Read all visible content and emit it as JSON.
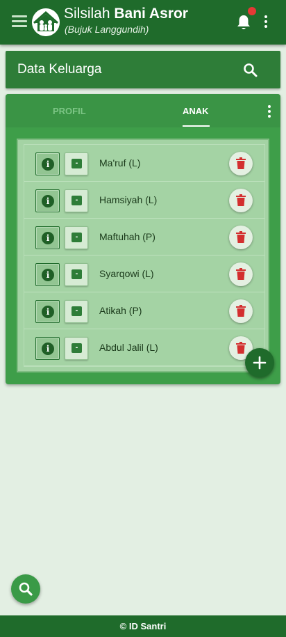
{
  "appbar": {
    "title_prefix": "Silsilah ",
    "title_bold": "Bani Asror",
    "subtitle": "(Bujuk Langgundih)",
    "menu_icon": "hamburger-menu-icon",
    "logo_icon": "family-house-logo",
    "notification_icon": "bell-icon",
    "notification_badge_color": "#e53935",
    "more_icon": "vertical-dots-icon"
  },
  "section": {
    "title": "Data Keluarga",
    "search_icon": "search-icon"
  },
  "tabs": [
    {
      "label": "PROFIL",
      "active": false
    },
    {
      "label": "ANAK",
      "active": true
    }
  ],
  "children": [
    {
      "name": "Ma'ruf (L)",
      "info_label": "i",
      "minus_label": "-"
    },
    {
      "name": "Hamsiyah (L)",
      "info_label": "i",
      "minus_label": "-"
    },
    {
      "name": "Maftuhah (P)",
      "info_label": "i",
      "minus_label": "-"
    },
    {
      "name": "Syarqowi (L)",
      "info_label": "i",
      "minus_label": "-"
    },
    {
      "name": "Atikah (P)",
      "info_label": "i",
      "minus_label": "-"
    },
    {
      "name": "Abdul Jalil (L)",
      "info_label": "i",
      "minus_label": "-"
    }
  ],
  "fab_add_icon": "plus-icon",
  "fab_search_icon": "search-icon",
  "footer": {
    "text": "© ID Santri"
  },
  "colors": {
    "primary_dark": "#1f6b2b",
    "primary": "#2e7d38",
    "card": "#3e9e49",
    "delete": "#d32f2f",
    "background": "#e3efe3"
  }
}
